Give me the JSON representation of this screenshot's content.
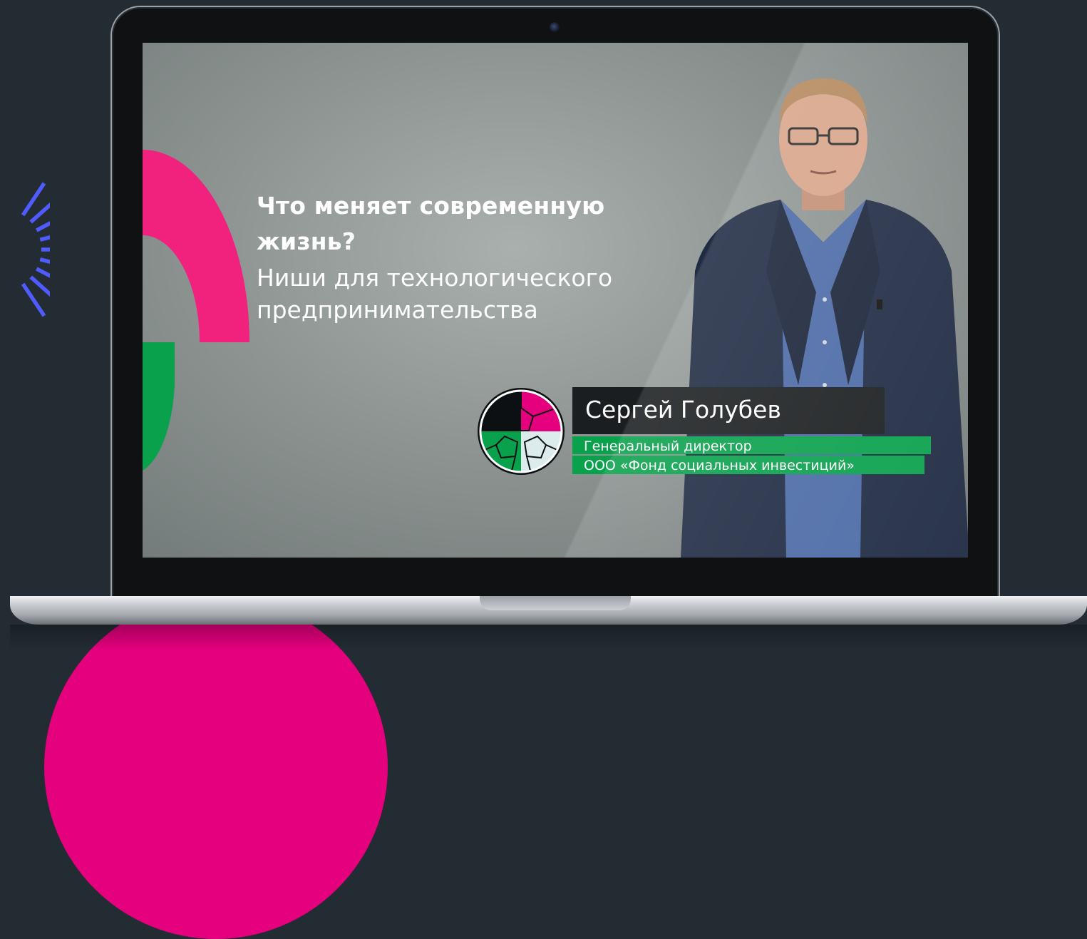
{
  "video": {
    "title_bold": "Что меняет современную жизнь?",
    "title_sub": "Ниши для технологического предпринимательства"
  },
  "lower_third": {
    "name": "Сергей Голубев",
    "role": "Генеральный директор",
    "organization": "ООО «Фонд социальных инвестиций»"
  },
  "icons": {
    "logo": "fullerene-ball-logo",
    "decoration": "starburst-lines",
    "camera": "webcam-dot"
  },
  "colors": {
    "background": "#232c33",
    "magenta": "#e5007e",
    "pink_screen": "#f0227e",
    "green": "#09a14c",
    "burst_blue": "#4f5bff",
    "name_box": "#1b1e20"
  }
}
